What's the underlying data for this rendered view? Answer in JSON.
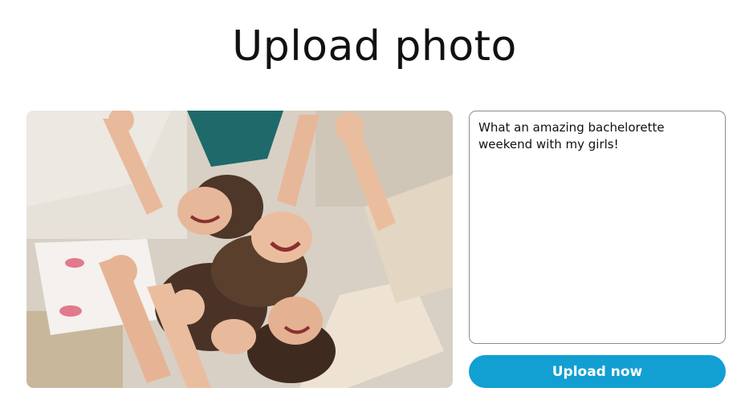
{
  "page": {
    "title": "Upload photo"
  },
  "photo": {
    "alt": "Group of smiling women lying on a bed with hands joined"
  },
  "caption": {
    "value": "What an amazing bachelorette weekend with my girls!"
  },
  "upload_button": {
    "label": "Upload now"
  },
  "colors": {
    "accent": "#129fd2",
    "text": "#111111",
    "border": "#8c8c8c"
  }
}
